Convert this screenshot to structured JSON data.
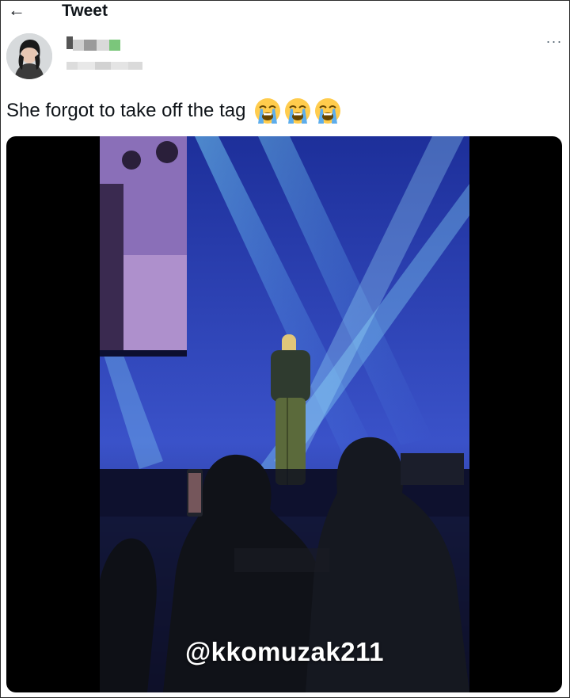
{
  "header": {
    "back_icon": "arrow-left-icon",
    "title": "Tweet"
  },
  "author": {
    "avatar_icon": "profile-photo",
    "name_redacted": true,
    "handle_redacted": true,
    "more_icon": "ellipsis-icon",
    "more_label": "···"
  },
  "tweet": {
    "text": "She forgot to take off the tag",
    "emojis": [
      "loudly-crying-face",
      "loudly-crying-face",
      "loudly-crying-face"
    ]
  },
  "media": {
    "type": "video",
    "watermark": "@kkomuzak211",
    "description_colors": {
      "stage_blue": "#2c45b8",
      "background": "#000000"
    }
  }
}
